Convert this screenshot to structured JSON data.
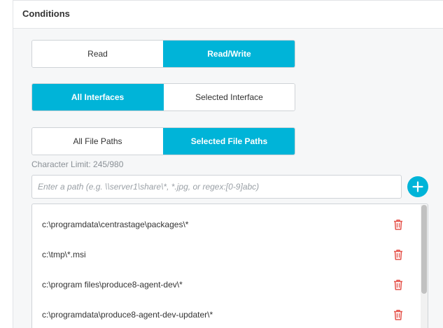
{
  "section": {
    "title": "Conditions"
  },
  "access_toggle": {
    "options": [
      "Read",
      "Read/Write"
    ],
    "selected": "Read/Write"
  },
  "interface_toggle": {
    "options": [
      "All Interfaces",
      "Selected Interface"
    ],
    "selected": "All Interfaces"
  },
  "filepath_toggle": {
    "options": [
      "All File Paths",
      "Selected File Paths"
    ],
    "selected": "Selected File Paths"
  },
  "char_limit": "Character Limit: 245/980",
  "path_input": {
    "placeholder": "Enter a path (e.g. \\\\server1\\share\\*, *.jpg, or regex:[0-9]abc)",
    "value": ""
  },
  "paths": [
    "c:\\programdata\\centrastage\\packages\\*",
    "c:\\tmp\\*.msi",
    "c:\\program files\\produce8-agent-dev\\*",
    "c:\\programdata\\produce8-agent-dev-updater\\*"
  ],
  "colors": {
    "accent": "#00b4d8",
    "delete": "#e5534b",
    "border": "#cfd3d7"
  },
  "icons": {
    "add": "plus-icon",
    "delete": "trash-icon"
  }
}
